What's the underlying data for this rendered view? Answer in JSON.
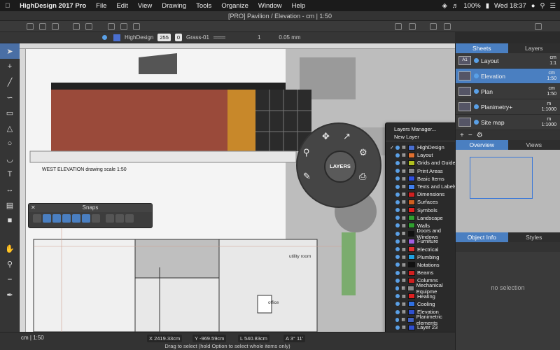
{
  "menubar": {
    "app_name": "HighDesign 2017 Pro",
    "items": [
      "File",
      "Edit",
      "View",
      "Drawing",
      "Tools",
      "Organize",
      "Window",
      "Help"
    ],
    "battery": "100%",
    "clock": "Wed 18:37"
  },
  "window": {
    "title": "[PRO] Pavilion / Elevation - cm | 1:50"
  },
  "toolbar": {
    "layer_name": "HighDesign",
    "pen_value": "255",
    "line_value": "0",
    "hatch_name": "Grass-01",
    "line_weight": "0.05 mm",
    "scale_field": "1"
  },
  "canvas": {
    "elevation_label": "WEST  ELEVATION  drawing scale 1:50",
    "room1": "utility room",
    "room2": "office"
  },
  "snaps": {
    "title": "Snaps"
  },
  "radial_menu": {
    "center_label": "LAYERS"
  },
  "layers_menu": {
    "manager": "Layers Manager...",
    "new_layer": "New Layer",
    "layers": [
      {
        "name": "HighDesign",
        "color": "#4a6fd0",
        "checked": true
      },
      {
        "name": "Layout",
        "color": "#e07030"
      },
      {
        "name": "Grids and Guides",
        "color": "#b0c020"
      },
      {
        "name": "Print Areas",
        "color": "#888888"
      },
      {
        "name": "Basic Items",
        "color": "#3050e0"
      },
      {
        "name": "Texts and Labels",
        "color": "#4080f0"
      },
      {
        "name": "Dimensions",
        "color": "#d02020"
      },
      {
        "name": "Surfaces",
        "color": "#d06020"
      },
      {
        "name": "Symbols",
        "color": "#e02020"
      },
      {
        "name": "Landscape",
        "color": "#30a030"
      },
      {
        "name": "Walls",
        "color": "#30a030"
      },
      {
        "name": "Doors and Windows",
        "color": "#111111"
      },
      {
        "name": "Furniture",
        "color": "#a060e0"
      },
      {
        "name": "Electrical",
        "color": "#e03030"
      },
      {
        "name": "Plumbing",
        "color": "#20a0e0"
      },
      {
        "name": "Notations",
        "color": "#111111"
      },
      {
        "name": "Beams",
        "color": "#d02020"
      },
      {
        "name": "Columns",
        "color": "#d02020"
      },
      {
        "name": "Mechanical Equipme",
        "color": "#888888"
      },
      {
        "name": "Heating",
        "color": "#e02020"
      },
      {
        "name": "Cooling",
        "color": "#3070e0"
      },
      {
        "name": "Elevation",
        "color": "#3050d0"
      },
      {
        "name": "Planimetric elements",
        "color": "#4060c0"
      },
      {
        "name": "Layer 23",
        "color": "#3050d0"
      }
    ]
  },
  "right_panel": {
    "tabs": [
      "Sheets",
      "Layers"
    ],
    "sheets": [
      {
        "thumb": "A1",
        "name": "Layout",
        "scale_top": "cm",
        "scale_bot": "1:1"
      },
      {
        "name": "Elevation",
        "scale_top": "cm",
        "scale_bot": "1:50",
        "active": true
      },
      {
        "name": "Plan",
        "scale_top": "cm",
        "scale_bot": "1:50"
      },
      {
        "name": "Planimetry+",
        "scale_top": "m",
        "scale_bot": "1:1000"
      },
      {
        "name": "Site map",
        "scale_top": "m",
        "scale_bot": "1:1000"
      }
    ],
    "view_tabs": [
      "Overview",
      "Views"
    ],
    "info_tabs": [
      "Object Info",
      "Styles"
    ],
    "no_selection": "no selection"
  },
  "statusbar": {
    "units": "cm | 1:50",
    "x": "2419.33cm",
    "y": "-969.59cm",
    "l": "540.83cm",
    "a": "3° 11'",
    "hint": "Drag to select (hold Option to select whole items only)"
  }
}
